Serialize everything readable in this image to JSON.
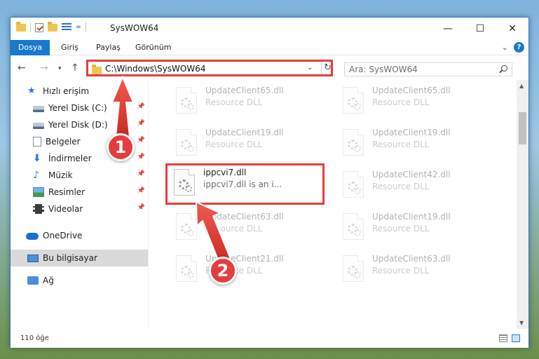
{
  "window": {
    "title": "SysWOW64",
    "quick_access_dropdown": "=",
    "minimize": "—",
    "maximize": "☐",
    "close": "✕"
  },
  "ribbon": {
    "tabs": [
      "Dosya",
      "Giriş",
      "Paylaş",
      "Görünüm"
    ],
    "expand": "⌄",
    "help": "?"
  },
  "address": {
    "back": "←",
    "forward": "→",
    "recent": "▾",
    "up": "↑",
    "path": "C:\\Windows\\SysWOW64",
    "dropdown": "⌄",
    "refresh": "↻",
    "search_placeholder": "Ara: SysWOW64"
  },
  "nav": {
    "items": [
      {
        "label": "Hızlı erişim",
        "icon": "star-icon"
      },
      {
        "label": "Yerel Disk (C:)",
        "icon": "drive-icon",
        "pinned": true
      },
      {
        "label": "Yerel Disk (D:)",
        "icon": "drive-icon",
        "pinned": true
      },
      {
        "label": "Belgeler",
        "icon": "documents-icon",
        "pinned": true
      },
      {
        "label": "İndirmeler",
        "icon": "downloads-icon",
        "pinned": true
      },
      {
        "label": "Müzik",
        "icon": "music-icon",
        "pinned": true
      },
      {
        "label": "Resimler",
        "icon": "pictures-icon",
        "pinned": true
      },
      {
        "label": "Videolar",
        "icon": "videos-icon",
        "pinned": true
      },
      {
        "label": "OneDrive",
        "icon": "onedrive-icon"
      },
      {
        "label": "Bu bilgisayar",
        "icon": "computer-icon",
        "selected": true
      },
      {
        "label": "Ağ",
        "icon": "network-icon"
      }
    ],
    "pin_glyph": "📌"
  },
  "files": {
    "col1": [
      {
        "name": "UpdateClient65.dll",
        "desc": "Resource DLL"
      },
      {
        "name": "UpdateClient19.dll",
        "desc": "Resource DLL"
      },
      {
        "name": "ippcvi7.dll",
        "desc": "ippcvi7.dll is an i...",
        "highlighted": true
      },
      {
        "name": "UpdateClient63.dll",
        "desc": "Resource DLL"
      },
      {
        "name": "UpdateClient21.dll",
        "desc": "Resource DLL"
      }
    ],
    "col2": [
      {
        "name": "UpdateClient65.dll",
        "desc": "Resource DLL"
      },
      {
        "name": "UpdateClient19.dll",
        "desc": "Resource DLL"
      },
      {
        "name": "UpdateClient42.dll",
        "desc": "Resource DLL"
      },
      {
        "name": "UpdateClient19.dll",
        "desc": "Resource DLL"
      },
      {
        "name": "UpdateClient63.dll",
        "desc": "Resource DLL"
      }
    ]
  },
  "scroll": {
    "up": "▲",
    "down": "▼"
  },
  "status": {
    "count": "110 öğe"
  },
  "annotations": {
    "step1": "1",
    "step2": "2"
  },
  "colors": {
    "accent": "#1979ca",
    "highlight": "#e53d3d"
  }
}
